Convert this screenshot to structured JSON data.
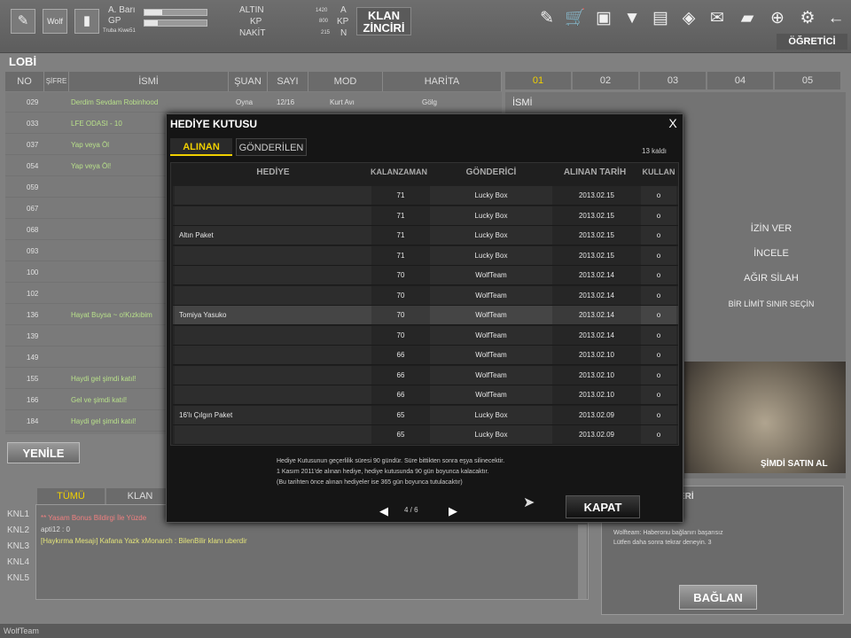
{
  "topbar": {
    "rank_label": "A. Barı",
    "gp_label": "GP",
    "user_small": "Truba Kiwe51",
    "altin_label": "ALTIN",
    "kp_label": "KP",
    "nakit_label": "NAKİT",
    "altin_value": "1420",
    "kp_value": "800",
    "nakit_value": "215",
    "a_label": "A",
    "kp2_label": "KP",
    "n_label": "N",
    "klan_line1": "KLAN",
    "klan_line2": "ZİNCİRİ",
    "ogretici": "ÖĞRETİCİ"
  },
  "lobby": {
    "title": "LOBİ",
    "headers": [
      "NO",
      "ŞİFRE",
      "İSMİ",
      "ŞUAN",
      "SAYI",
      "MOD",
      "HARİTA"
    ],
    "rows": [
      {
        "no": "029",
        "name": "Derdim Sevdam Robinhood",
        "status": "Oyna",
        "count": "12/16",
        "mode": "Kurt Avı",
        "map": "Gölg"
      },
      {
        "no": "033",
        "name": "LFE ODASI - 10",
        "status": "",
        "count": "",
        "mode": "",
        "map": ""
      },
      {
        "no": "037",
        "name": "Yap veya Öl",
        "status": "",
        "count": "",
        "mode": "",
        "map": ""
      },
      {
        "no": "054",
        "name": "Yap veya Öl!",
        "status": "",
        "count": "",
        "mode": "",
        "map": ""
      },
      {
        "no": "059",
        "name": "",
        "status": "",
        "count": "",
        "mode": "",
        "map": ""
      },
      {
        "no": "067",
        "name": "",
        "status": "",
        "count": "",
        "mode": "",
        "map": ""
      },
      {
        "no": "068",
        "name": "",
        "status": "",
        "count": "",
        "mode": "",
        "map": ""
      },
      {
        "no": "093",
        "name": "",
        "status": "",
        "count": "",
        "mode": "",
        "map": ""
      },
      {
        "no": "100",
        "name": "",
        "status": "",
        "count": "",
        "mode": "",
        "map": ""
      },
      {
        "no": "102",
        "name": "",
        "status": "",
        "count": "",
        "mode": "",
        "map": ""
      },
      {
        "no": "136",
        "name": "Hayat Buysa ~ o!Kızkıbim",
        "status": "",
        "count": "",
        "mode": "",
        "map": ""
      },
      {
        "no": "139",
        "name": "",
        "status": "",
        "count": "",
        "mode": "",
        "map": ""
      },
      {
        "no": "149",
        "name": "",
        "status": "",
        "count": "",
        "mode": "",
        "map": ""
      },
      {
        "no": "155",
        "name": "Haydi gel şimdi katıl!",
        "status": "",
        "count": "",
        "mode": "",
        "map": ""
      },
      {
        "no": "166",
        "name": "Gel ve şimdi katıl!",
        "status": "",
        "count": "",
        "mode": "",
        "map": ""
      },
      {
        "no": "184",
        "name": "Haydi gel şimdi katıl!",
        "status": "",
        "count": "",
        "mode": "",
        "map": ""
      }
    ],
    "refresh_button": "YENİLE"
  },
  "room": {
    "tabs": [
      "01",
      "02",
      "03",
      "04",
      "05"
    ],
    "name_label": "İSMİ",
    "actions": [
      "İZİN VER",
      "İNCELE",
      "AĞIR SİLAH",
      "BİR LİMİT SINIR SEÇİN"
    ],
    "promo_label": "ŞİMDİ SATIN AL"
  },
  "chat": {
    "tabs": [
      "TÜMÜ",
      "KLAN"
    ],
    "channels": [
      "KNL1",
      "KNL2",
      "KNL3",
      "KNL4",
      "KNL5"
    ],
    "lines": [
      "** Yasam Bonus Bildirgi İle Yüzde",
      "apti12 : 0",
      "[Haykırma Mesajı] Kafana Yazk xMonarch : BilenBilir klanı uberdir"
    ],
    "right_title": "ERİ",
    "right_msg1": "Wolfteam: Haberonu bağlanırı başarısız",
    "right_msg2": "Lütfen daha sonra tekrar deneyin. 3",
    "connect_button": "BAĞLAN",
    "status_bar": "WolfTeam"
  },
  "modal": {
    "title": "HEDİYE KUTUSU",
    "close": "X",
    "tab_received": "ALINAN",
    "tab_sent": "GÖNDERİLEN",
    "remaining": "13 kaldı",
    "headers": [
      "HEDİYE",
      "KALANZAMAN",
      "GÖNDERİCİ",
      "ALINAN TARİH",
      "KULLAN"
    ],
    "rows": [
      {
        "gift": "",
        "remaining": "71",
        "sender": "Lucky Box",
        "date": "2013.02.15",
        "use": "o"
      },
      {
        "gift": "",
        "remaining": "71",
        "sender": "Lucky Box",
        "date": "2013.02.15",
        "use": "o"
      },
      {
        "gift": "Altın Paket",
        "remaining": "71",
        "sender": "Lucky Box",
        "date": "2013.02.15",
        "use": "o"
      },
      {
        "gift": "",
        "remaining": "71",
        "sender": "Lucky Box",
        "date": "2013.02.15",
        "use": "o"
      },
      {
        "gift": "",
        "remaining": "70",
        "sender": "WolfTeam",
        "date": "2013.02.14",
        "use": "o"
      },
      {
        "gift": "",
        "remaining": "70",
        "sender": "WolfTeam",
        "date": "2013.02.14",
        "use": "o"
      },
      {
        "gift": "Tomiya Yasuko",
        "remaining": "70",
        "sender": "WolfTeam",
        "date": "2013.02.14",
        "use": "o"
      },
      {
        "gift": "",
        "remaining": "70",
        "sender": "WolfTeam",
        "date": "2013.02.14",
        "use": "o"
      },
      {
        "gift": "",
        "remaining": "66",
        "sender": "WolfTeam",
        "date": "2013.02.10",
        "use": "o"
      },
      {
        "gift": "",
        "remaining": "66",
        "sender": "WolfTeam",
        "date": "2013.02.10",
        "use": "o"
      },
      {
        "gift": "",
        "remaining": "66",
        "sender": "WolfTeam",
        "date": "2013.02.10",
        "use": "o"
      },
      {
        "gift": "16'lı Çılgın Paket",
        "remaining": "65",
        "sender": "Lucky Box",
        "date": "2013.02.09",
        "use": "o"
      },
      {
        "gift": "",
        "remaining": "65",
        "sender": "Lucky Box",
        "date": "2013.02.09",
        "use": "o"
      }
    ],
    "note1": "Hediye Kutusunun geçerlilik süresi 90 gündür. Süre bittikten sonra eşya silinecektir.",
    "note2": "1 Kasım 2011'de alınan hediye, hediye kutusunda 90 gün boyunca kalacaktır.",
    "note3": "(Bu tarihten önce alınan hediyeler ise 365 gün boyunca tutulacaktır)",
    "page": "4 / 6",
    "prev": "◀",
    "next": "▶",
    "close_button": "KAPAT"
  }
}
